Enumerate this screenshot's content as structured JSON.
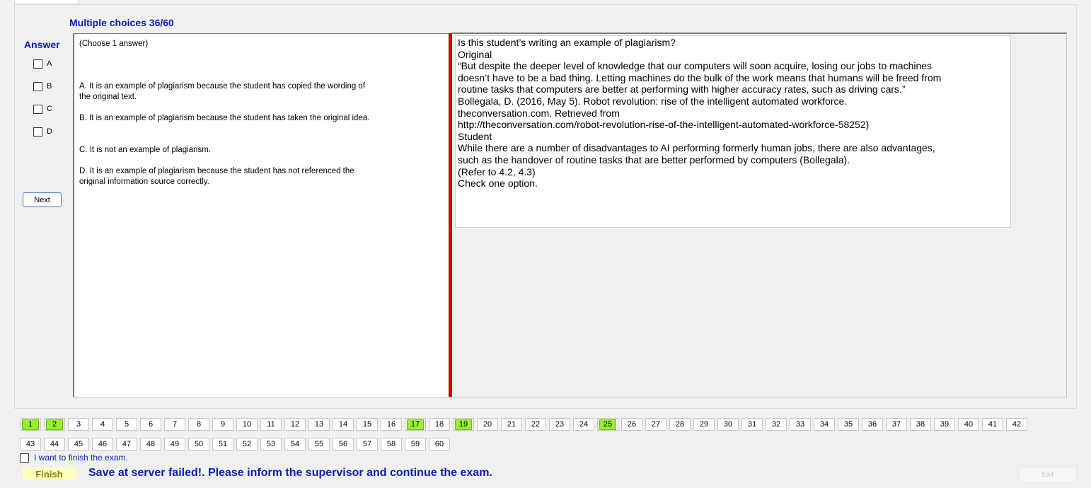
{
  "header": {
    "title": "Multiple choices 36/60"
  },
  "answer": {
    "label": "Answer",
    "choices": [
      "A",
      "B",
      "C",
      "D"
    ],
    "next_label": "Next"
  },
  "options_panel": {
    "instruction": "(Choose 1 answer)",
    "options": [
      "A.  It is an example of plagiarism because the student has copied the wording of the original text.",
      "B.  It is an example of plagiarism because the student has taken the original idea.",
      "C.  It is not an example of plagiarism.",
      "D.  It is an example of plagiarism because the student has not referenced the original information source correctly."
    ]
  },
  "question": {
    "lines": [
      "Is this student’s writing an example of plagiarism?",
      "Original",
      "“But despite the deeper level of knowledge that our computers will soon acquire, losing our jobs to machines",
      "doesn’t have to be a bad thing. Letting machines do the bulk of the work means that humans will be freed from",
      "routine tasks that computers are better at performing with higher accuracy rates, such as driving cars.”",
      "Bollegala, D. (2016, May 5). Robot revolution: rise of the intelligent automated workforce.",
      "theconversation.com. Retrieved from",
      "http://theconversation.com/robot-revolution-rise-of-the-intelligent-automated-workforce-58252)",
      "Student",
      "While there are a number of disadvantages to AI performing formerly human jobs, there are also advantages,",
      "such as the handover of routine tasks that are better performed by computers (Bollegala).",
      "(Refer to 4.2, 4.3)",
      "Check one option."
    ]
  },
  "navigator": {
    "questions": [
      "1",
      "2",
      "3",
      "4",
      "5",
      "6",
      "7",
      "8",
      "9",
      "10",
      "11",
      "12",
      "13",
      "14",
      "15",
      "16",
      "17",
      "18",
      "19",
      "20",
      "21",
      "22",
      "23",
      "24",
      "25",
      "26",
      "27",
      "28",
      "29",
      "30",
      "31",
      "32",
      "33",
      "34",
      "35",
      "36",
      "37",
      "38",
      "39",
      "40",
      "41",
      "42",
      "43",
      "44",
      "45",
      "46",
      "47",
      "48",
      "49",
      "50",
      "51",
      "52",
      "53",
      "54",
      "55",
      "56",
      "57",
      "58",
      "59",
      "60"
    ],
    "answered": [
      1,
      2,
      17,
      19,
      25
    ],
    "answered_color": "#98f02e"
  },
  "footer": {
    "finish_checkbox_label": "I want to finish the exam.",
    "finish_label": "Finish",
    "status_message": "Save at server failed!. Please inform the supervisor and continue the exam.",
    "exit_label": "Exit"
  }
}
